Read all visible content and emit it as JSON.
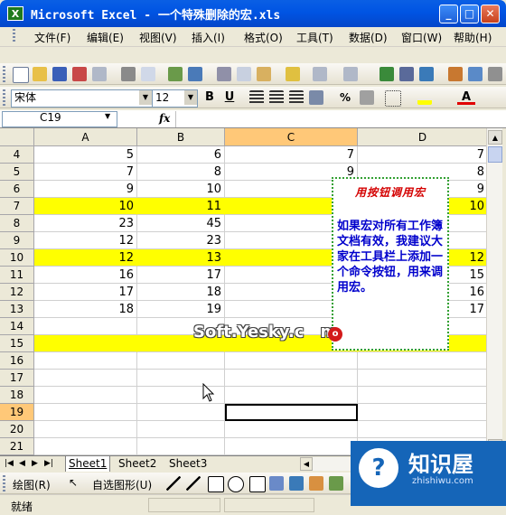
{
  "window": {
    "title": "Microsoft Excel - 一个特殊删除的宏.xls",
    "icon_letter": "X",
    "minimize": "_",
    "maximize": "□",
    "close": "✕"
  },
  "menu": [
    "文件(F)",
    "编辑(E)",
    "视图(V)",
    "插入(I)",
    "格式(O)",
    "工具(T)",
    "数据(D)",
    "窗口(W)",
    "帮助(H)"
  ],
  "format_toolbar": {
    "font": "宋体",
    "size": "12",
    "bold": "B",
    "underline": "U",
    "percent": "%"
  },
  "formula_bar": {
    "name_box": "C19",
    "fx": "fx"
  },
  "columns": [
    "A",
    "B",
    "C",
    "D"
  ],
  "rows": [
    {
      "n": "4",
      "a": "5",
      "b": "6",
      "c": "7",
      "d": "7",
      "hl": false
    },
    {
      "n": "5",
      "a": "7",
      "b": "8",
      "c": "9",
      "d": "8",
      "hl": false
    },
    {
      "n": "6",
      "a": "9",
      "b": "10",
      "c": "",
      "d": "9",
      "hl": false
    },
    {
      "n": "7",
      "a": "10",
      "b": "11",
      "c": "",
      "d": "10",
      "hl": true
    },
    {
      "n": "8",
      "a": "23",
      "b": "45",
      "c": "",
      "d": "",
      "hl": false
    },
    {
      "n": "9",
      "a": "12",
      "b": "23",
      "c": "",
      "d": "",
      "hl": false
    },
    {
      "n": "10",
      "a": "12",
      "b": "13",
      "c": "",
      "d": "12",
      "hl": true
    },
    {
      "n": "11",
      "a": "16",
      "b": "17",
      "c": "",
      "d": "15",
      "hl": false
    },
    {
      "n": "12",
      "a": "17",
      "b": "18",
      "c": "",
      "d": "16",
      "hl": false
    },
    {
      "n": "13",
      "a": "18",
      "b": "19",
      "c": "",
      "d": "17",
      "hl": false
    },
    {
      "n": "14",
      "a": "",
      "b": "",
      "c": "",
      "d": "",
      "hl": false
    },
    {
      "n": "15",
      "a": "",
      "b": "",
      "c": "",
      "d": "",
      "hl": true
    },
    {
      "n": "16",
      "a": "",
      "b": "",
      "c": "",
      "d": "",
      "hl": false
    },
    {
      "n": "17",
      "a": "",
      "b": "",
      "c": "",
      "d": "",
      "hl": false
    },
    {
      "n": "18",
      "a": "",
      "b": "",
      "c": "",
      "d": "",
      "hl": false
    },
    {
      "n": "19",
      "a": "",
      "b": "",
      "c": "",
      "d": "",
      "hl": false
    },
    {
      "n": "20",
      "a": "",
      "b": "",
      "c": "",
      "d": "",
      "hl": false
    },
    {
      "n": "21",
      "a": "",
      "b": "",
      "c": "",
      "d": "",
      "hl": false
    }
  ],
  "selected_cell": "C19",
  "colors": {
    "highlight": "#ffff00",
    "selected_header": "#ffc878",
    "note_border": "#33a033"
  },
  "note": {
    "title": "用按钮调用宏",
    "body": "如果宏对所有工作簿文档有效，我建议大家在工具栏上添加一个命令按钮，用来调用宏。"
  },
  "watermark": {
    "text": "Soft.Yesky.c",
    "badge": "o",
    "suffix": "m"
  },
  "sheet_tabs": [
    "Sheet1",
    "Sheet2",
    "Sheet3"
  ],
  "draw_toolbar": {
    "draw": "绘图(R)",
    "autoshapes": "自选图形(U)"
  },
  "status": "就绪",
  "logo": {
    "text": "知识屋",
    "sub": "zhishiwu.com",
    "mark": "?"
  }
}
